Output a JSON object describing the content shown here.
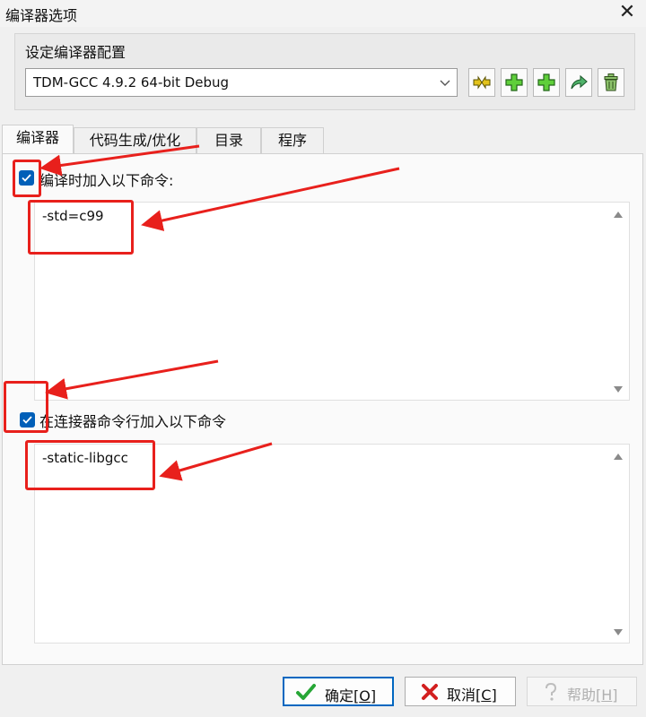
{
  "window": {
    "title": "编译器选项",
    "close_glyph": "✕"
  },
  "config": {
    "group_label": "设定编译器配置",
    "selected": "TDM-GCC 4.9.2 64-bit Debug",
    "toolbar_icons": [
      "rename-icon",
      "add-config-icon",
      "add-from-folder-icon",
      "import-icon",
      "delete-config-icon"
    ]
  },
  "tabs": [
    {
      "label": "编译器",
      "active": true
    },
    {
      "label": "代码生成/优化",
      "active": false
    },
    {
      "label": "目录",
      "active": false
    },
    {
      "label": "程序",
      "active": false
    }
  ],
  "compile": {
    "checkbox_label": "编译时加入以下命令:",
    "checked": true,
    "value": "-std=c99"
  },
  "linker": {
    "checkbox_label": "在连接器命令行加入以下命令",
    "checked": true,
    "value": "-static-libgcc"
  },
  "buttons": {
    "ok": {
      "label": "确定",
      "hotkey": "O"
    },
    "cancel": {
      "label": "取消",
      "hotkey": "C"
    },
    "help": {
      "label": "帮助",
      "hotkey": "H",
      "enabled": false
    }
  },
  "colors": {
    "accent": "#005fb8",
    "annotation_red": "#e8201c",
    "default_button_border": "#0067c0"
  }
}
